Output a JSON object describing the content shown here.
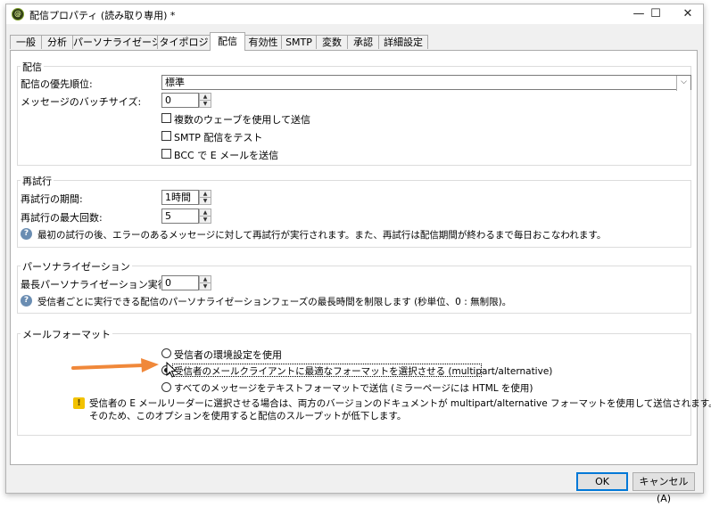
{
  "window": {
    "title": "配信プロパティ (読み取り専用) *",
    "minimize": "—",
    "maximize": "☐",
    "close": "✕"
  },
  "tabs": [
    {
      "label": "一般"
    },
    {
      "label": "分析"
    },
    {
      "label": "パーソナライゼーション"
    },
    {
      "label": "タイポロジ"
    },
    {
      "label": "配信"
    },
    {
      "label": "有効性"
    },
    {
      "label": "SMTP"
    },
    {
      "label": "変数"
    },
    {
      "label": "承認"
    },
    {
      "label": "詳細設定"
    }
  ],
  "delivery": {
    "title": "配信",
    "priority_label": "配信の優先順位:",
    "priority_value": "標準",
    "batch_label": "メッセージのバッチサイズ:",
    "batch_value": "0",
    "checkboxes": [
      {
        "label": "複数のウェーブを使用して送信",
        "checked": false
      },
      {
        "label": "SMTP 配信をテスト",
        "checked": false
      },
      {
        "label": "BCC で E メールを送信",
        "checked": false
      }
    ]
  },
  "retry": {
    "title": "再試行",
    "period_label": "再試行の期間:",
    "period_value": "1時間",
    "max_label": "再試行の最大回数:",
    "max_value": "5",
    "help": "最初の試行の後、エラーのあるメッセージに対して再試行が実行されます。また、再試行は配信期間が終わるまで毎日おこなわれます。"
  },
  "personalization": {
    "title": "パーソナライゼーション",
    "max_time_label": "最長パーソナライゼーション実行時間:",
    "max_time_value": "0",
    "help": "受信者ごとに実行できる配信のパーソナライゼーションフェーズの最長時間を制限します (秒単位、0 : 無制限)。"
  },
  "mail_format": {
    "title": "メールフォーマット",
    "options": [
      {
        "label": "受信者の環境設定を使用",
        "selected": false
      },
      {
        "label": "受信者のメールクライアントに最適なフォーマットを選択させる (multipart/alternative)",
        "selected": true
      },
      {
        "label": "すべてのメッセージをテキストフォーマットで送信 (ミラーページには HTML を使用)",
        "selected": false
      }
    ],
    "warning_line1": "受信者の E メールリーダーに選択させる場合は、両方のバージョンのドキュメントが multipart/alternative フォーマットを使用して送信されます。",
    "warning_line2": "そのため、このオプションを使用すると配信のスループットが低下します。"
  },
  "buttons": {
    "ok": "OK",
    "cancel": "キャンセル(A)"
  },
  "colors": {
    "annotation_arrow": "#f0883a",
    "accent": "#0078d7"
  }
}
